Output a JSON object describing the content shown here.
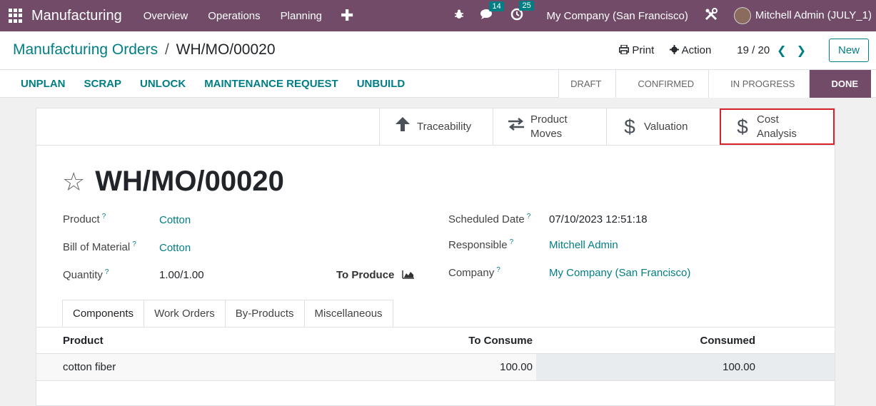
{
  "topbar": {
    "app_name": "Manufacturing",
    "menu": [
      "Overview",
      "Operations",
      "Planning"
    ],
    "plus": "✚",
    "chat_badge": "14",
    "activity_badge": "25",
    "company": "My Company (San Francisco)",
    "user": "Mitchell Admin (JULY_1)"
  },
  "breadcrumb": {
    "parent": "Manufacturing Orders",
    "separator": "/",
    "current": "WH/MO/00020"
  },
  "control": {
    "print": "Print",
    "action": "Action",
    "pager": "19 / 20",
    "new": "New"
  },
  "actions": [
    "UNPLAN",
    "SCRAP",
    "UNLOCK",
    "MAINTENANCE REQUEST",
    "UNBUILD"
  ],
  "stages": [
    "DRAFT",
    "CONFIRMED",
    "IN PROGRESS",
    "DONE"
  ],
  "smart_buttons": {
    "traceability": "Traceability",
    "product_moves_1": "Product",
    "product_moves_2": "Moves",
    "valuation": "Valuation",
    "cost_1": "Cost",
    "cost_2": "Analysis"
  },
  "record": {
    "title": "WH/MO/00020",
    "product_label": "Product",
    "product": "Cotton",
    "bom_label": "Bill of Material",
    "bom": "Cotton",
    "quantity_label": "Quantity",
    "quantity": "1.00/1.00",
    "to_produce": "To Produce",
    "scheduled_label": "Scheduled Date",
    "scheduled": "07/10/2023 12:51:18",
    "responsible_label": "Responsible",
    "responsible": "Mitchell Admin",
    "company_label": "Company",
    "company": "My Company (San Francisco)",
    "help": "?"
  },
  "tabs": [
    "Components",
    "Work Orders",
    "By-Products",
    "Miscellaneous"
  ],
  "table": {
    "headers": {
      "product": "Product",
      "to_consume": "To Consume",
      "consumed": "Consumed"
    },
    "rows": [
      {
        "product": "cotton fiber",
        "to_consume": "100.00",
        "consumed": "100.00"
      }
    ]
  }
}
